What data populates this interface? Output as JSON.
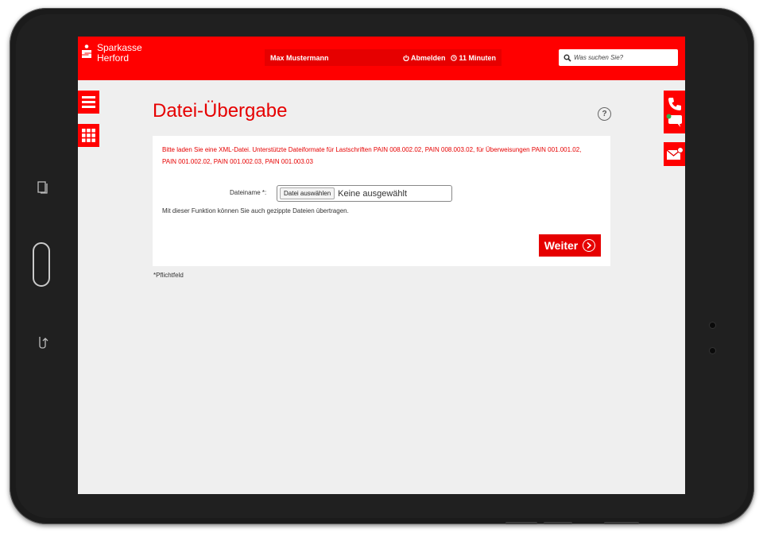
{
  "brand": {
    "line1": "Sparkasse",
    "line2": "Herford"
  },
  "header": {
    "user_name": "Max Mustermann",
    "logout_label": "Abmelden",
    "session_timer": "11 Minuten",
    "search_placeholder": "Was suchen Sie?"
  },
  "page": {
    "title": "Datei-Übergabe",
    "help_label": "?",
    "notice": "Bitte laden Sie eine XML-Datei. Unterstützte Dateiformate für Lastschriften PAIN 008.002.02, PAIN 008.003.02, für Überweisungen PAIN 001.001.02, PAIN 001.002.02, PAIN 001.002.03, PAIN 001.003.03",
    "field_label": "Dateiname *:",
    "file_button_label": "Datei auswählen",
    "file_status": "Keine ausgewählt",
    "hint": "Mit dieser Funktion können Sie auch gezippte Dateien übertragen.",
    "next_button_label": "Weiter",
    "footnote": "*Pflichtfeld"
  },
  "colors": {
    "brand_red": "#ff0000",
    "accent_red": "#e60000",
    "page_background": "#efefef"
  },
  "icons": {
    "header": [
      "power-icon",
      "clock-icon",
      "search-icon"
    ],
    "side_left": [
      "menu-icon",
      "apps-grid-icon"
    ],
    "side_right": [
      "phone-icon",
      "chat-icon",
      "mail-icon"
    ]
  }
}
